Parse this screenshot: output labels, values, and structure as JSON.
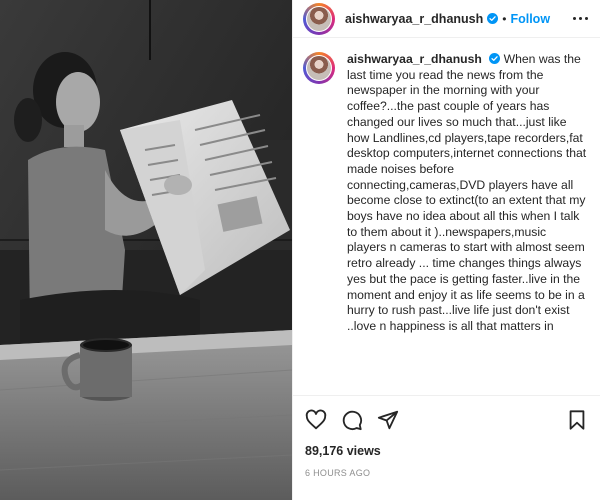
{
  "post": {
    "username": "aishwaryaa_r_dhanush",
    "header_separator": "•",
    "follow_label": "Follow",
    "caption": "When was the last time you read the news from the newspaper in the morning with your coffee?...the past couple of years has changed our lives so much that...just like how Landlines,cd players,tape recorders,fat desktop computers,internet connections that made noises before connecting,cameras,DVD players have all become close to extinct(to an extent that my boys have no idea about all this when I talk to them about it )..newspapers,music players n cameras to start with almost seem retro already ... time changes things always yes but the pace is getting faster..live in the moment and enjoy it as life seems to be in a hurry to rush past...live life just don't exist ..love n happiness is all that matters in",
    "views": "89,176 views",
    "time_ago": "6 HOURS AGO"
  },
  "icons": {
    "verified": "verified-badge-icon",
    "more": "more-options-icon",
    "like": "heart-icon",
    "comment": "comment-icon",
    "share": "share-icon",
    "save": "bookmark-icon"
  },
  "colors": {
    "accent": "#0095f6",
    "text": "#262626",
    "muted": "#8e8e8e",
    "border": "#efefef"
  }
}
